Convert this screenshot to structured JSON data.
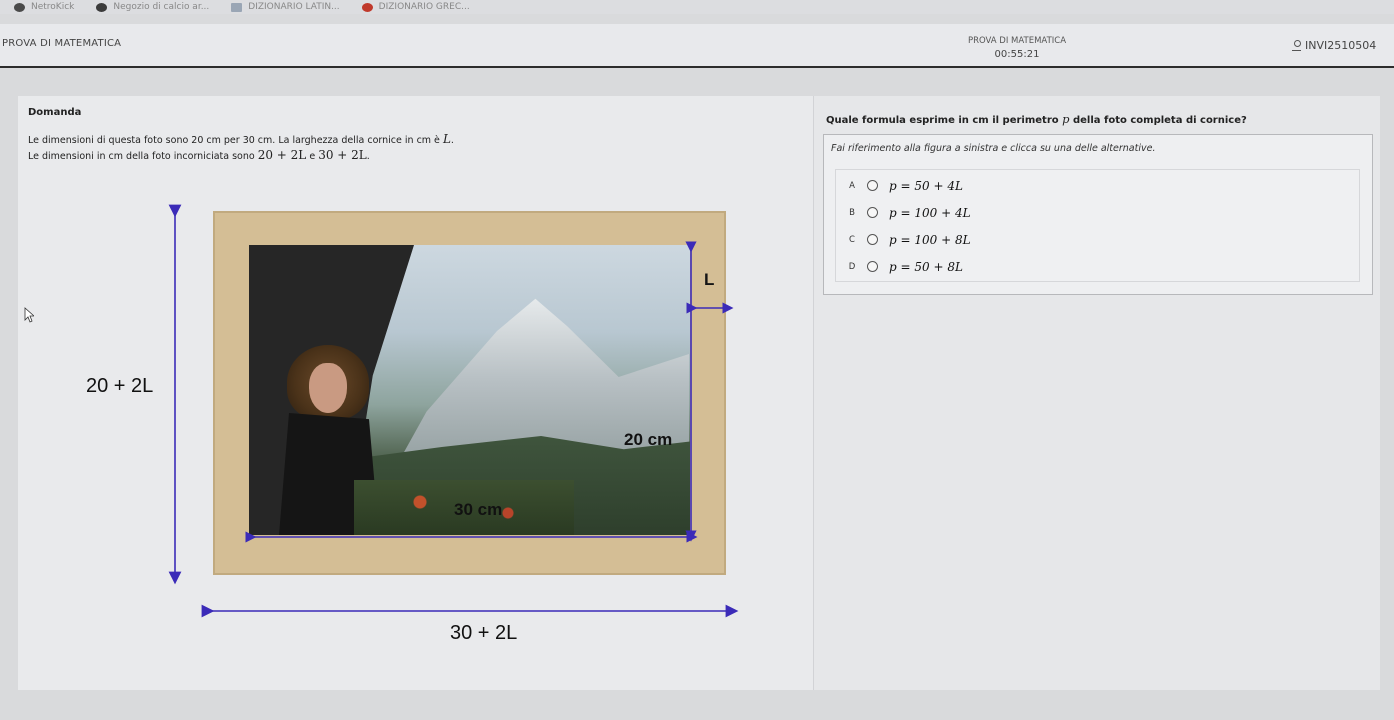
{
  "bookmarks": [
    {
      "label": "NetroKick",
      "icon": "netrokick-icon",
      "color": "#4a4a4a"
    },
    {
      "label": "Negozio di calcio ar...",
      "icon": "soccer-ball-icon",
      "color": "#3b3b3b"
    },
    {
      "label": "DIZIONARIO LATIN...",
      "icon": "dictionary-icon",
      "color": "#9aa6b5"
    },
    {
      "label": "DIZIONARIO GREC...",
      "icon": "dictionary-red-icon",
      "color": "#c0392b"
    }
  ],
  "header": {
    "section": "PROVA DI MATEMATICA",
    "test_name": "PROVA DI MATEMATICA",
    "timer": "00:55:21",
    "user_code": "INVI2510504"
  },
  "question": {
    "heading": "Domanda",
    "stem_line1_text": "Le dimensioni di questa foto sono 20 cm per 30 cm. La larghezza della cornice in cm è",
    "stem_line1_var": "L",
    "stem_line1_end": ".",
    "stem_line2_text": "Le dimensioni in cm della foto incorniciata sono",
    "stem_line2_expr1": "20 + 2L",
    "stem_line2_and": "e",
    "stem_line2_expr2": "30 + 2L",
    "stem_line2_end": ".",
    "prompt_before": "Quale formula esprime in cm il perimetro",
    "prompt_var": "p",
    "prompt_after": "della foto completa di cornice?",
    "instruction": "Fai riferimento alla figura a sinistra e clicca su una delle alternative."
  },
  "figure": {
    "label_L": "L",
    "label_height_photo": "20 cm",
    "label_width_photo": "30 cm",
    "label_height_total": "20 + 2L",
    "label_width_total": "30 + 2L",
    "arrow_color": "#3b2bb8"
  },
  "options": [
    {
      "letter": "A",
      "formula": "p = 50 + 4L"
    },
    {
      "letter": "B",
      "formula": "p = 100 + 4L"
    },
    {
      "letter": "C",
      "formula": "p = 100 + 8L"
    },
    {
      "letter": "D",
      "formula": "p = 50 + 8L"
    }
  ]
}
